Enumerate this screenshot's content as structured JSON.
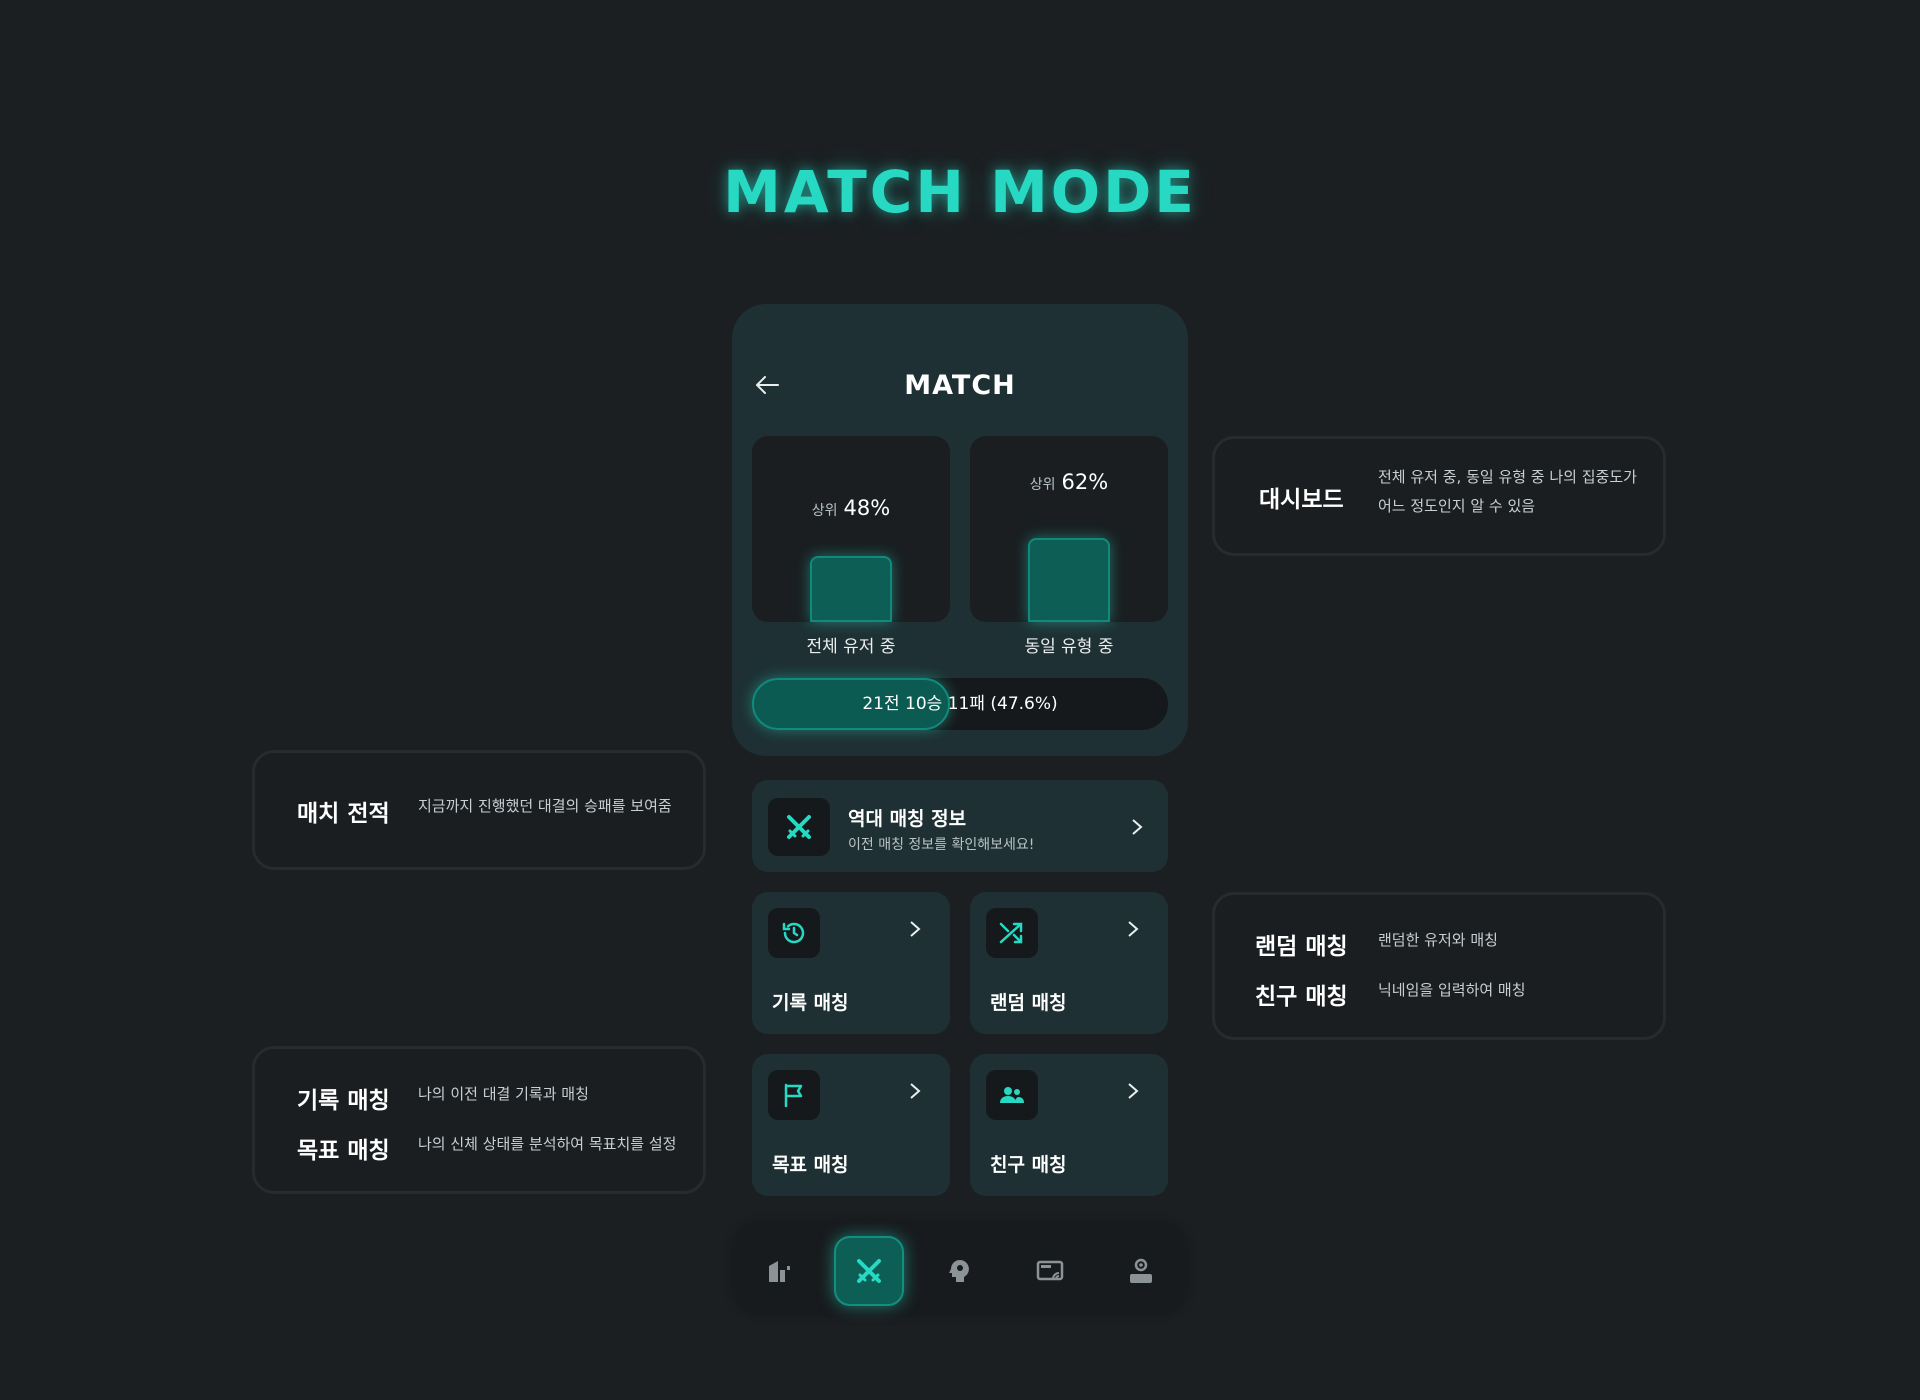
{
  "hero_title": "MATCH MODE",
  "app": {
    "title": "MATCH",
    "rank_cards": [
      {
        "prefix": "상위",
        "value": "48%",
        "label": "전체 유저 중",
        "percent": 48
      },
      {
        "prefix": "상위",
        "value": "62%",
        "label": "동일 유형 중",
        "percent": 62
      }
    ],
    "record": {
      "text": "21전 10승 11패 (47.6%)",
      "win_rate": 47.6
    },
    "history_card": {
      "title": "역대 매칭 정보",
      "subtitle": "이전 매칭 정보를 확인해보세요!",
      "icon": "crossed-swords-icon"
    },
    "mode_cards": [
      {
        "label": "기록 매칭",
        "icon": "history-clock-icon"
      },
      {
        "label": "랜덤 매칭",
        "icon": "shuffle-icon"
      },
      {
        "label": "목표 매칭",
        "icon": "flag-icon"
      },
      {
        "label": "친구 매칭",
        "icon": "friends-icon"
      }
    ],
    "bottom_nav": [
      {
        "icon": "home-icon",
        "active": false
      },
      {
        "icon": "crossed-swords-icon",
        "active": true
      },
      {
        "icon": "head-brain-icon",
        "active": false
      },
      {
        "icon": "monitor-broadcast-icon",
        "active": false
      },
      {
        "icon": "profile-icon",
        "active": false
      }
    ],
    "accent_color": "#27d9c2"
  },
  "annotations": {
    "dashboard": {
      "title": "대시보드",
      "desc_line1": "전체 유저 중, 동일 유형 중 나의 집중도가",
      "desc_line2": "어느 정도인지 알 수 있음"
    },
    "match_record": {
      "title": "매치 전적",
      "desc": "지금까지 진행했던 대결의 승패를 보여줌"
    },
    "random_friend": {
      "random_title": "랜덤 매칭",
      "random_desc": "랜덤한 유저와 매칭",
      "friend_title": "친구 매칭",
      "friend_desc": "닉네임을 입력하여 매칭"
    },
    "record_goal": {
      "record_title": "기록 매칭",
      "record_desc": "나의 이전 대결 기록과 매칭",
      "goal_title": "목표 매칭",
      "goal_desc": "나의 신체 상태를 분석하여 목표치를 설정"
    }
  }
}
